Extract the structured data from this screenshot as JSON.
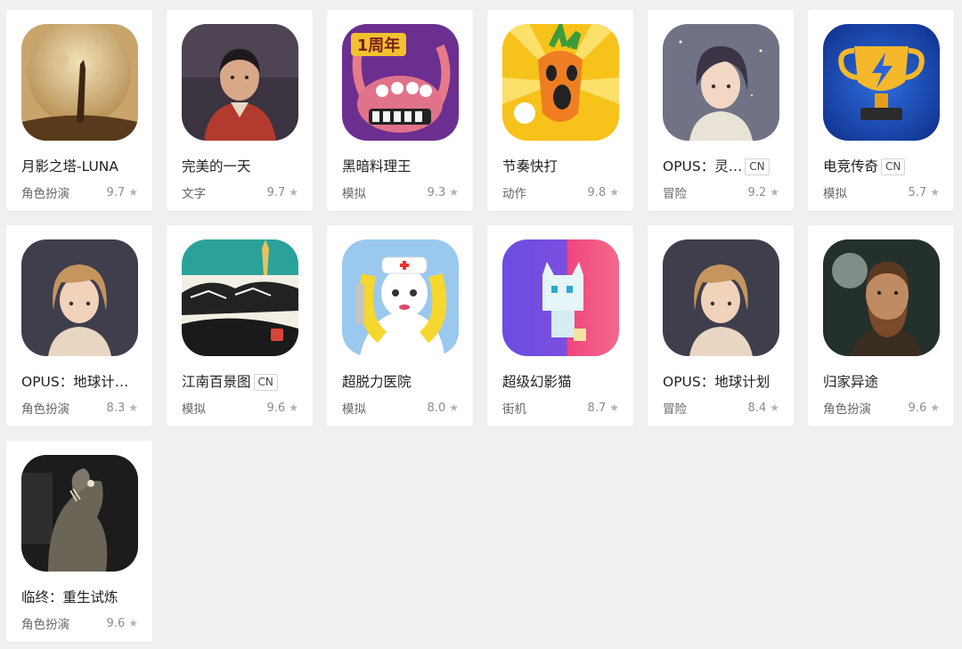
{
  "apps": [
    {
      "name": "月影之塔-LUNA",
      "genre": "角色扮演",
      "rating": "9.7",
      "badge": "",
      "icon": "luna-moon-tower-icon"
    },
    {
      "name": "完美的一天",
      "genre": "文字",
      "rating": "9.7",
      "badge": "",
      "icon": "perfect-day-girl-icon"
    },
    {
      "name": "黑暗料理王",
      "genre": "模拟",
      "rating": "9.3",
      "badge": "",
      "icon": "dark-cuisine-monster-icon"
    },
    {
      "name": "节奏快打",
      "genre": "动作",
      "rating": "9.8",
      "badge": "",
      "icon": "carrot-rhythm-icon"
    },
    {
      "name": "OPUS：灵…",
      "genre": "冒险",
      "rating": "9.2",
      "badge": "CN",
      "icon": "opus-spirit-girl-icon"
    },
    {
      "name": "电竞传奇",
      "genre": "模拟",
      "rating": "5.7",
      "badge": "CN",
      "icon": "trophy-lightning-icon"
    },
    {
      "name": "OPUS：地球计…",
      "genre": "角色扮演",
      "rating": "8.3",
      "badge": "",
      "icon": "opus-earth-girl-icon"
    },
    {
      "name": "江南百景图",
      "genre": "模拟",
      "rating": "9.6",
      "badge": "CN",
      "icon": "jiangnan-town-icon"
    },
    {
      "name": "超脱力医院",
      "genre": "模拟",
      "rating": "8.0",
      "badge": "",
      "icon": "nurse-cat-icon"
    },
    {
      "name": "超级幻影猫",
      "genre": "街机",
      "rating": "8.7",
      "badge": "",
      "icon": "phantom-cat-icon"
    },
    {
      "name": "OPUS：地球计划",
      "genre": "冒险",
      "rating": "8.4",
      "badge": "",
      "icon": "opus-earth-girl-icon"
    },
    {
      "name": "归家异途",
      "genre": "角色扮演",
      "rating": "9.6",
      "badge": "",
      "icon": "bearded-man-icon"
    },
    {
      "name": "临终：重生试炼",
      "genre": "角色扮演",
      "rating": "9.6",
      "badge": "",
      "icon": "fish-monster-icon"
    }
  ],
  "rating_icon": "star-icon"
}
